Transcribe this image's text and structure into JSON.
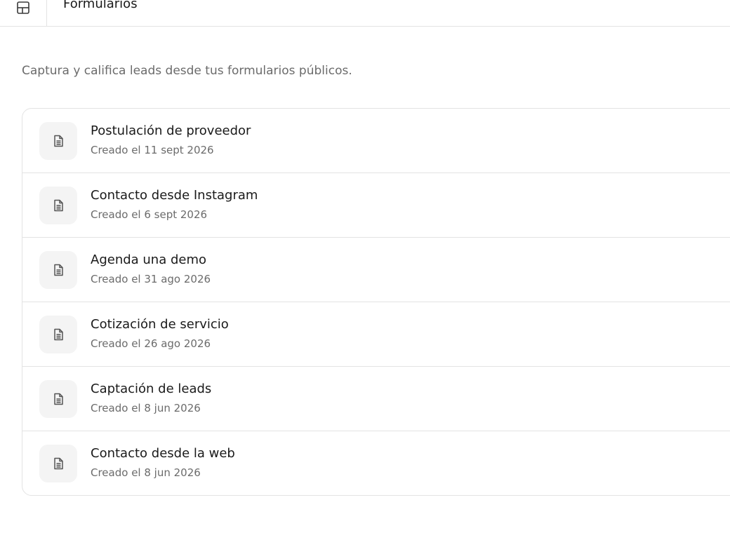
{
  "topbar": {
    "title": "Formularios",
    "sidebar_icon": "sidebar-panel-icon"
  },
  "subtitle": "Captura y califica leads desde tus formularios públicos.",
  "forms": [
    {
      "name": "Postulación de proveedor",
      "created": "Creado el 11 sept 2026",
      "icon": "document-icon"
    },
    {
      "name": "Contacto desde Instagram",
      "created": "Creado el 6 sept 2026",
      "icon": "document-icon"
    },
    {
      "name": "Agenda una demo",
      "created": "Creado el 31 ago 2026",
      "icon": "document-icon"
    },
    {
      "name": "Cotización de servicio",
      "created": "Creado el 26 ago 2026",
      "icon": "document-icon"
    },
    {
      "name": "Captación de leads",
      "created": "Creado el 8 jun 2026",
      "icon": "document-icon"
    },
    {
      "name": "Contacto desde la web",
      "created": "Creado el 8 jun 2026",
      "icon": "document-icon"
    }
  ],
  "colors": {
    "text_primary": "#1a1a1a",
    "text_secondary": "#6b6b6b",
    "border": "#e3e3e3",
    "icon_bg": "#f4f4f4"
  }
}
